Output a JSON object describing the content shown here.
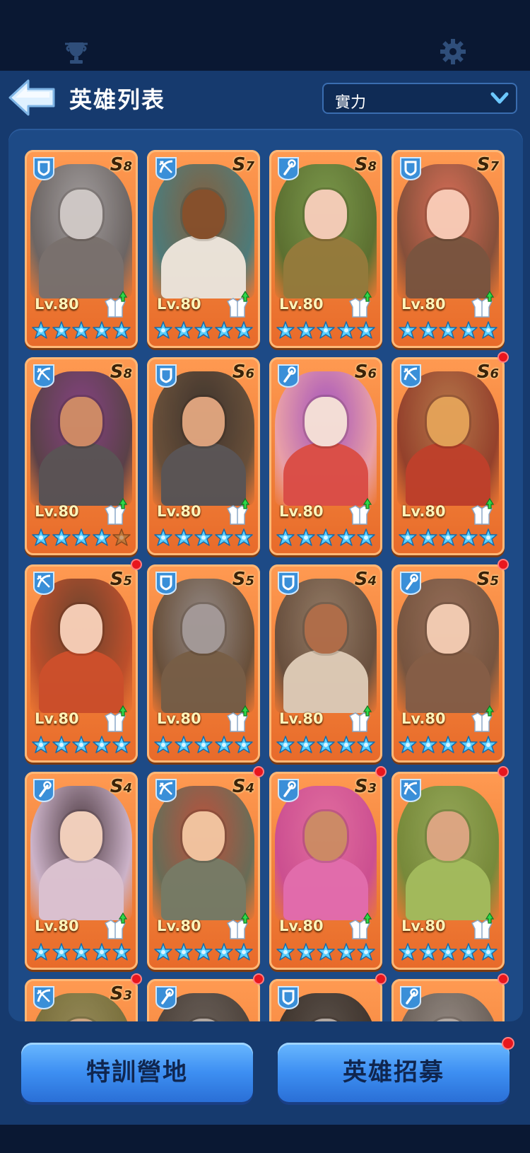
{
  "header": {
    "title": "英雄列表",
    "sort_value": "實力"
  },
  "heroes": [
    {
      "class": "shield",
      "tier": "8",
      "level": "Lv.80",
      "stars": 5,
      "dot": false,
      "c1": "#9aa0a8",
      "c2": "#5e6268",
      "skin": "#c9cdd2",
      "cloth": "#6d6f73"
    },
    {
      "class": "bow",
      "tier": "7",
      "level": "Lv.80",
      "stars": 5,
      "dot": false,
      "c1": "#7a5a3c",
      "c2": "#3c7a80",
      "skin": "#7a4a2a",
      "cloth": "#e9ece8"
    },
    {
      "class": "staff",
      "tier": "8",
      "level": "Lv.80",
      "stars": 5,
      "dot": false,
      "c1": "#6e9a4c",
      "c2": "#4c6e30",
      "skin": "#f2d2c2",
      "cloth": "#8a7a3c"
    },
    {
      "class": "shield",
      "tier": "7",
      "level": "Lv.80",
      "stars": 5,
      "dot": false,
      "c1": "#d86c5a",
      "c2": "#7a4a3a",
      "skin": "#f7cfc0",
      "cloth": "#6e5040"
    },
    {
      "class": "bow",
      "tier": "8",
      "level": "Lv.80",
      "stars": 4,
      "dot": false,
      "c1": "#7a3a8a",
      "c2": "#4a3a4a",
      "skin": "#c98a6a",
      "cloth": "#4a4e58"
    },
    {
      "class": "shield",
      "tier": "6",
      "level": "Lv.80",
      "stars": 5,
      "dot": false,
      "c1": "#2a2a2a",
      "c2": "#5a4a3a",
      "skin": "#d9a583",
      "cloth": "#4a5058"
    },
    {
      "class": "staff",
      "tier": "6",
      "level": "Lv.80",
      "stars": 5,
      "dot": false,
      "c1": "#9a4ac8",
      "c2": "#e8a3b3",
      "skin": "#f3e6e6",
      "cloth": "#d84a4a"
    },
    {
      "class": "bow",
      "tier": "6",
      "level": "Lv.80",
      "stars": 5,
      "dot": true,
      "c1": "#b0744a",
      "c2": "#8a3a2a",
      "skin": "#e0a35a",
      "cloth": "#b83a2a"
    },
    {
      "class": "bow",
      "tier": "5",
      "level": "Lv.80",
      "stars": 5,
      "dot": true,
      "c1": "#5a3a2a",
      "c2": "#b84a2a",
      "skin": "#f3d2c0",
      "cloth": "#c84a2a"
    },
    {
      "class": "shield",
      "tier": "5",
      "level": "Lv.80",
      "stars": 5,
      "dot": false,
      "c1": "#8a8a8e",
      "c2": "#5a4a3a",
      "skin": "#9a9aa0",
      "cloth": "#6a5a48"
    },
    {
      "class": "shield",
      "tier": "4",
      "level": "Lv.80",
      "stars": 5,
      "dot": false,
      "c1": "#8a7a6a",
      "c2": "#5a4a3e",
      "skin": "#a86a4a",
      "cloth": "#d8cfc0"
    },
    {
      "class": "staff",
      "tier": "5",
      "level": "Lv.80",
      "stars": 5,
      "dot": true,
      "c1": "#8a6a5a",
      "c2": "#6a5040",
      "skin": "#f0d0bc",
      "cloth": "#7a5a48"
    },
    {
      "class": "staff",
      "tier": "4",
      "level": "Lv.80",
      "stars": 5,
      "dot": false,
      "c1": "#3a3040",
      "c2": "#c8b8d8",
      "skin": "#f0d6c8",
      "cloth": "#d8c8e0"
    },
    {
      "class": "bow",
      "tier": "4",
      "level": "Lv.80",
      "stars": 5,
      "dot": true,
      "c1": "#b84a3a",
      "c2": "#5a6a5a",
      "skin": "#f0c8a8",
      "cloth": "#6a7a6a"
    },
    {
      "class": "staff",
      "tier": "3",
      "level": "Lv.80",
      "stars": 5,
      "dot": true,
      "c1": "#e06aa8",
      "c2": "#c84a9a",
      "skin": "#c88a6a",
      "cloth": "#e06ab8"
    },
    {
      "class": "bow",
      "tier": "",
      "level": "Lv.80",
      "stars": 5,
      "dot": true,
      "c1": "#8aaa5a",
      "c2": "#6a8a3a",
      "skin": "#d8a888",
      "cloth": "#9ac060"
    },
    {
      "class": "bow",
      "tier": "3",
      "level": "",
      "stars": 0,
      "dot": true,
      "c1": "#8a8a5a",
      "c2": "#6a6a3a",
      "skin": "#c8a888",
      "cloth": "#7a7a4a"
    },
    {
      "class": "staff",
      "tier": "",
      "level": "",
      "stars": 0,
      "dot": true,
      "c1": "#5a5a5a",
      "c2": "#3a3a3a",
      "skin": "#aaa",
      "cloth": "#555"
    },
    {
      "class": "shield",
      "tier": "",
      "level": "",
      "stars": 0,
      "dot": true,
      "c1": "#4a4a4a",
      "c2": "#2a2a2a",
      "skin": "#aaa",
      "cloth": "#555"
    },
    {
      "class": "staff",
      "tier": "",
      "level": "",
      "stars": 0,
      "dot": true,
      "c1": "#8a8a8a",
      "c2": "#5a5a5a",
      "skin": "#aaa",
      "cloth": "#555"
    }
  ],
  "buttons": {
    "training": "特訓營地",
    "recruit": "英雄招募"
  },
  "colors": {
    "background": "#163a6e",
    "card_orange": "#f08038",
    "notify_red": "#e8161e",
    "star_cyan": "#5ad0ff"
  }
}
